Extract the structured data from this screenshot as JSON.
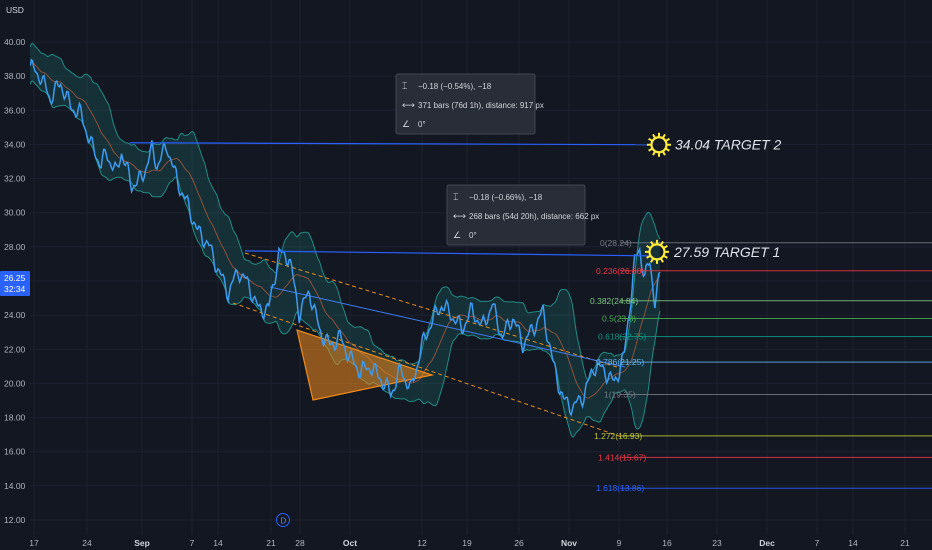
{
  "chart_data": {
    "type": "line",
    "currency": "USD",
    "ylim": [
      11.5,
      41.0
    ],
    "y_ticks": [
      "40.00",
      "38.00",
      "36.00",
      "34.00",
      "32.00",
      "30.00",
      "28.00",
      "26.00",
      "24.00",
      "22.00",
      "20.00",
      "18.00",
      "16.00",
      "14.00",
      "12.00"
    ],
    "x_tick_labels": [
      "17",
      "24",
      "Sep",
      "7",
      "14",
      "21",
      "28",
      "Oct",
      "12",
      "19",
      "26",
      "Nov",
      "9",
      "16",
      "23",
      "Dec",
      "7",
      "14",
      "21"
    ],
    "price_badge": {
      "value": "26.25",
      "countdown": "32:34"
    },
    "price_series": [
      [
        0,
        38.6
      ],
      [
        2,
        38.0
      ],
      [
        4,
        36.7
      ],
      [
        6,
        37.6
      ],
      [
        8,
        36.2
      ],
      [
        10,
        35.8
      ],
      [
        12,
        34.0
      ],
      [
        14,
        32.8
      ],
      [
        15,
        33.5
      ],
      [
        17,
        32.3
      ],
      [
        18,
        33.6
      ],
      [
        20,
        31.6
      ],
      [
        22,
        32.0
      ],
      [
        24,
        33.7
      ],
      [
        25,
        32.8
      ],
      [
        27,
        33.9
      ],
      [
        29,
        31.8
      ],
      [
        31,
        30.5
      ],
      [
        33,
        28.9
      ],
      [
        35,
        28.2
      ],
      [
        37,
        26.7
      ],
      [
        39,
        25.3
      ],
      [
        41,
        26.6
      ],
      [
        43,
        25.8
      ],
      [
        45,
        24.3
      ],
      [
        47,
        24.4
      ],
      [
        49,
        27.6
      ],
      [
        51,
        27.4
      ],
      [
        53,
        24.1
      ],
      [
        55,
        25.4
      ],
      [
        57,
        23.1
      ],
      [
        59,
        22.2
      ],
      [
        61,
        22.7
      ],
      [
        63,
        21.5
      ],
      [
        65,
        20.7
      ],
      [
        67,
        21.0
      ],
      [
        69,
        20.3
      ],
      [
        71,
        19.4
      ],
      [
        73,
        20.8
      ],
      [
        75,
        19.6
      ],
      [
        77,
        22.1
      ],
      [
        79,
        23.6
      ],
      [
        81,
        24.6
      ],
      [
        83,
        24.0
      ],
      [
        85,
        23.2
      ],
      [
        87,
        24.3
      ],
      [
        89,
        23.3
      ],
      [
        91,
        24.6
      ],
      [
        93,
        22.7
      ],
      [
        95,
        23.9
      ],
      [
        97,
        22.3
      ],
      [
        99,
        23.2
      ],
      [
        101,
        24.2
      ],
      [
        103,
        21.1
      ],
      [
        105,
        19.0
      ],
      [
        107,
        18.6
      ],
      [
        109,
        19.3
      ],
      [
        111,
        21.0
      ],
      [
        113,
        20.8
      ],
      [
        115,
        20.0
      ],
      [
        117,
        21.7
      ],
      [
        119,
        27.1
      ],
      [
        120,
        27.8
      ],
      [
        121,
        26.3
      ],
      [
        122,
        27.0
      ],
      [
        123,
        24.9
      ],
      [
        124,
        26.3
      ]
    ],
    "fibonacci": [
      {
        "label": "0(28.24)",
        "value": 28.24,
        "color": "#787b86"
      },
      {
        "label": "0.236(26.60)",
        "value": 26.6,
        "color": "#f23645"
      },
      {
        "label": "0.382(24.84)",
        "value": 24.84,
        "color": "#81c784"
      },
      {
        "label": "0.5(23.8)",
        "value": 23.8,
        "color": "#4caf50"
      },
      {
        "label": "0.618(22.75)",
        "value": 22.75,
        "color": "#089981"
      },
      {
        "label": "0.786(21.25)",
        "value": 21.25,
        "color": "#64b5f6"
      },
      {
        "label": "1(19.35)",
        "value": 19.35,
        "color": "#787b86"
      },
      {
        "label": "1.272(16.93)",
        "value": 16.93,
        "color": "#c0ca33"
      },
      {
        "label": "1.414(15.67)",
        "value": 15.67,
        "color": "#f23645"
      },
      {
        "label": "1.618(13.86)",
        "value": 13.86,
        "color": "#2962ff"
      }
    ],
    "targets": [
      {
        "label": "34.04 TARGET 2",
        "value": 34.04
      },
      {
        "label": "27.59 TARGET 1",
        "value": 27.59
      }
    ],
    "measure_boxes": [
      {
        "line1": "−0.18 (−0.54%), −18",
        "line2": "371 bars (76d 1h), distance: 917 px",
        "line3": "0°"
      },
      {
        "line1": "−0.18 (−0.66%), −18",
        "line2": "268 bars (54d 20h), distance: 662 px",
        "line3": "0°"
      }
    ],
    "dividend_marker": "D",
    "colors": {
      "background": "#131722",
      "grid": "#1e2230",
      "price": "#3d9bf0",
      "band": "#26a69a",
      "basis": "#c25e3c",
      "channel": "#e58f1b",
      "triangle": "#f08a1b",
      "target_line": "#2962ff",
      "sun": "#ffeb3b"
    }
  }
}
